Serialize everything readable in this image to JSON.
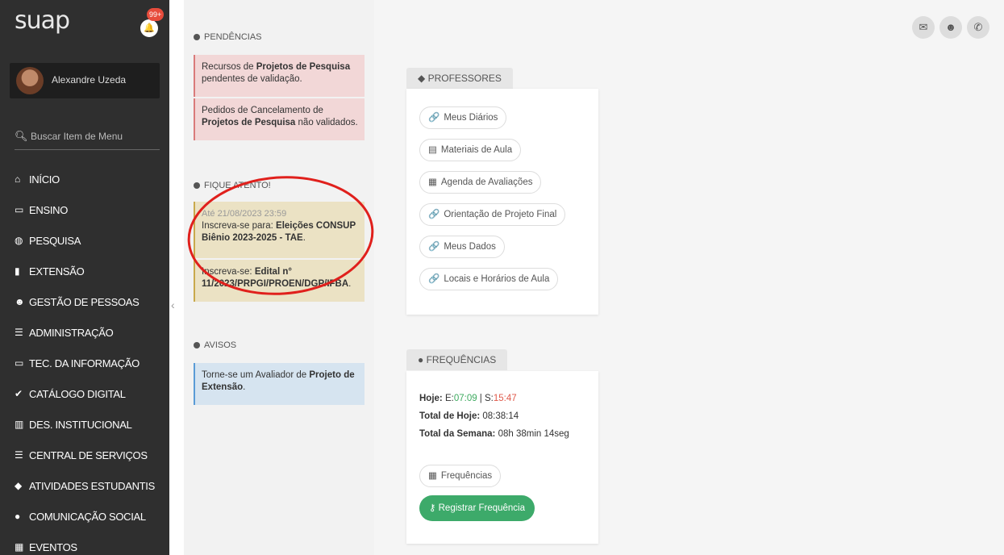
{
  "sidebar": {
    "logo": "suap",
    "notification_badge": "99+",
    "user_name": "Alexandre Uzeda",
    "search_placeholder": "Buscar Item de Menu",
    "items": [
      {
        "label": "INÍCIO",
        "icon": "home-icon",
        "glyph": "⌂"
      },
      {
        "label": "ENSINO",
        "icon": "board-icon",
        "glyph": "▭"
      },
      {
        "label": "PESQUISA",
        "icon": "globe-icon",
        "glyph": "◍"
      },
      {
        "label": "EXTENSÃO",
        "icon": "building-icon",
        "glyph": "▮"
      },
      {
        "label": "GESTÃO DE PESSOAS",
        "icon": "users-icon",
        "glyph": "☻"
      },
      {
        "label": "ADMINISTRAÇÃO",
        "icon": "list-icon",
        "glyph": "☰"
      },
      {
        "label": "TEC. DA INFORMAÇÃO",
        "icon": "laptop-icon",
        "glyph": "▭"
      },
      {
        "label": "CATÁLOGO DIGITAL",
        "icon": "check-circle-icon",
        "glyph": "✔"
      },
      {
        "label": "DES. INSTITUCIONAL",
        "icon": "chart-icon",
        "glyph": "▥"
      },
      {
        "label": "CENTRAL DE SERVIÇOS",
        "icon": "menu-icon",
        "glyph": "☰"
      },
      {
        "label": "ATIVIDADES ESTUDANTIS",
        "icon": "graduation-cap-icon",
        "glyph": "◆"
      },
      {
        "label": "COMUNICAÇÃO SOCIAL",
        "icon": "comment-icon",
        "glyph": "●"
      },
      {
        "label": "EVENTOS",
        "icon": "calendar-icon",
        "glyph": "▦"
      }
    ]
  },
  "pendencias": {
    "title": "PENDÊNCIAS",
    "items": [
      {
        "pre": "Recursos de ",
        "bold": "Projetos de Pesquisa",
        "post": " pendentes de validação."
      },
      {
        "pre": "Pedidos de Cancelamento de ",
        "bold": "Projetos de Pesquisa",
        "post": " não validados."
      }
    ]
  },
  "fique_atento": {
    "title": "FIQUE ATENTO!",
    "items": [
      {
        "date": "Até 21/08/2023 23:59",
        "pre": "Inscreva-se para: ",
        "bold": "Eleições CONSUP Biênio 2023-2025 - TAE",
        "post": "."
      },
      {
        "pre": "Inscreva-se: ",
        "bold": "Edital n° 11/2023/PRPGI/PROEN/DGP/IFBA",
        "post": "."
      }
    ]
  },
  "avisos": {
    "title": "AVISOS",
    "items": [
      {
        "pre": "Torne-se um Avaliador de ",
        "bold": "Projeto de Extensão",
        "post": "."
      }
    ]
  },
  "professores": {
    "title": "PROFESSORES",
    "links": [
      {
        "label": "Meus Diários",
        "icon": "link-icon",
        "glyph": "🔗"
      },
      {
        "label": "Materiais de Aula",
        "icon": "book-icon",
        "glyph": "▤"
      },
      {
        "label": "Agenda de Avaliações",
        "icon": "calendar-icon",
        "glyph": "▦"
      },
      {
        "label": "Orientação de Projeto Final",
        "icon": "link-icon",
        "glyph": "🔗"
      },
      {
        "label": "Meus Dados",
        "icon": "link-icon",
        "glyph": "🔗"
      },
      {
        "label": "Locais e Horários de Aula",
        "icon": "link-icon",
        "glyph": "🔗"
      }
    ]
  },
  "frequencias": {
    "title": "FREQUÊNCIAS",
    "hoje_label": "Hoje:",
    "entrada_prefix": "E:",
    "entrada": "07:09",
    "saida_prefix": "S:",
    "saida": "15:47",
    "total_hoje_label": "Total de Hoje:",
    "total_hoje": "08:38:14",
    "total_semana_label": "Total da Semana:",
    "total_semana": "08h 38min 14seg",
    "link_label": "Frequências",
    "button_label": "Registrar Frequência"
  },
  "colors": {
    "sidebar_bg": "#2f2f2f",
    "danger_card": "#f2d7d7",
    "warning_card": "#ebe2c4",
    "info_card": "#d6e4f0",
    "success": "#3daa6a",
    "annotation": "#e0201c"
  }
}
